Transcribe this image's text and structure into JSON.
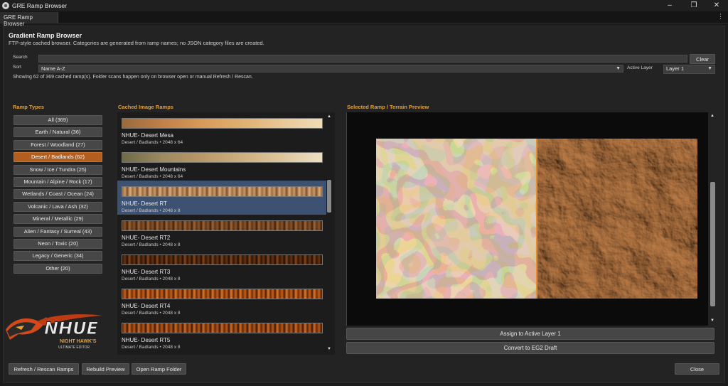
{
  "window": {
    "title": "GRE Ramp Browser",
    "tab_label": "GRE Ramp Browser",
    "menu_icon": "more-vertical-icon"
  },
  "header": {
    "title": "Gradient Ramp Browser",
    "subtitle": "FTP-style cached browser. Categories are generated from ramp names; no JSON category files are created."
  },
  "search": {
    "label": "Search",
    "value": "",
    "clear_label": "Clear"
  },
  "sort": {
    "label": "Sort",
    "selected": "Name A-Z"
  },
  "active_layer": {
    "label": "Active Layer",
    "selected": "Layer 1"
  },
  "status_text": "Showing 62 of 369 cached ramp(s). Folder scans happen only on browser open or manual Refresh / Rescan.",
  "sections": {
    "ramp_types": "Ramp Types",
    "cached_ramps": "Cached Image Ramps",
    "preview": "Selected Ramp / Terrain Preview"
  },
  "categories": [
    {
      "label": "All  (369)",
      "active": false
    },
    {
      "label": "Earth / Natural  (36)",
      "active": false
    },
    {
      "label": "Forest / Woodland  (27)",
      "active": false
    },
    {
      "label": "Desert / Badlands  (62)",
      "active": true
    },
    {
      "label": "Snow / Ice / Tundra  (25)",
      "active": false
    },
    {
      "label": "Mountain / Alpine / Rock  (17)",
      "active": false
    },
    {
      "label": "Wetlands / Coast / Ocean  (24)",
      "active": false
    },
    {
      "label": "Volcanic / Lava / Ash  (32)",
      "active": false
    },
    {
      "label": "Mineral / Metallic  (29)",
      "active": false
    },
    {
      "label": "Alien / Fantasy / Surreal  (43)",
      "active": false
    },
    {
      "label": "Neon / Toxic  (20)",
      "active": false
    },
    {
      "label": "Legacy / Generic  (34)",
      "active": false
    },
    {
      "label": "Other  (20)",
      "active": false
    }
  ],
  "ramps": [
    {
      "name": "NHUE- Desert Mesa",
      "meta": "Desert / Badlands  •  2048 x 64",
      "selected": false,
      "gradient": "linear-gradient(90deg,#9a6a3c 0%,#c08048 20%,#d89a58 40%,#e0b070 60%,#e8c896 80%,#efdcb8 100%)"
    },
    {
      "name": "NHUE- Desert Mountains",
      "meta": "Desert / Badlands  •  2048 x 64",
      "selected": false,
      "gradient": "linear-gradient(90deg,#6e6a48 0%,#9c8a60 20%,#b89868 40%,#cdb080 60%,#ddc69c 80%,#ece0c4 100%)"
    },
    {
      "name": "NHUE- Desert RT",
      "meta": "Desert / Badlands  •  2048 x 8",
      "selected": true,
      "gradient": "repeating-linear-gradient(90deg,#9a6a40 0px,#c89a68 4px,#7a5030 7px,#d8b080 11px,#a87850 14px)"
    },
    {
      "name": "NHUE- Desert RT2",
      "meta": "Desert / Badlands  •  2048 x 8",
      "selected": false,
      "gradient": "repeating-linear-gradient(90deg,#5a3418 0px,#8a5428 4px,#3c200e 7px,#a06838 10px,#6a3e1a 13px)"
    },
    {
      "name": "NHUE- Desert RT3",
      "meta": "Desert / Badlands  •  2048 x 8",
      "selected": false,
      "gradient": "repeating-linear-gradient(90deg,#2a1406 0px,#6a3410 4px,#1e0e04 7px,#8a4818 10px,#3a1c08 13px)"
    },
    {
      "name": "NHUE- Desert RT4",
      "meta": "Desert / Badlands  •  2048 x 8",
      "selected": false,
      "gradient": "repeating-linear-gradient(90deg,#6a2a08 0px,#c8601a 4px,#4a1c04 7px,#e07a28 10px,#8a3a0c 13px)"
    },
    {
      "name": "NHUE- Desert RT5",
      "meta": "Desert / Badlands  •  2048 x 8",
      "selected": false,
      "gradient": "repeating-linear-gradient(90deg,#5a2406 0px,#b85a1a 4px,#3a1604 7px,#d07028 10px,#7a3008 13px)"
    }
  ],
  "actions": {
    "assign": "Assign to Active Layer 1",
    "convert": "Convert to EG2 Draft",
    "refresh": "Refresh / Rescan Ramps",
    "rebuild": "Rebuild Preview",
    "open_folder": "Open Ramp Folder",
    "close": "Close"
  },
  "logo": {
    "name": "NHUE",
    "tagline": "NIGHT HAWK'S",
    "subtag": "ULTIMATE EDITOR"
  },
  "colors": {
    "accent": "#e0a040",
    "active_category": "#b25e1e",
    "selection": "#3d5273"
  }
}
